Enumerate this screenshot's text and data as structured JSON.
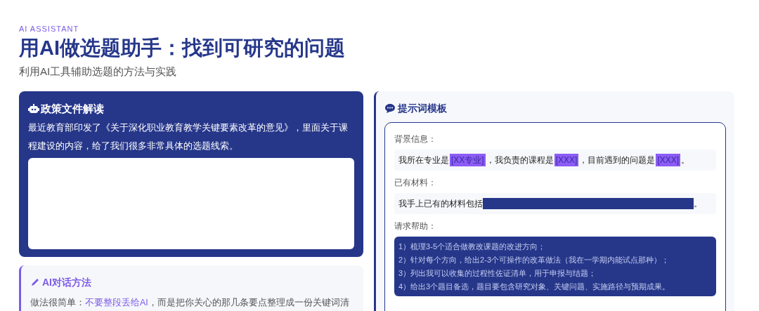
{
  "header": {
    "eyebrow": "AI ASSISTANT",
    "title": "用AI做选题助手：找到可研究的问题",
    "subtitle": "利用AI工具辅助选题的方法与实践"
  },
  "policy_card": {
    "title": "政策文件解读",
    "body": "最近教育部印发了《关于深化职业教育教学关键要素改革的意见》，里面关于课程建设的内容，给了我们很多非常具体的选题线索。"
  },
  "method_card": {
    "title": "AI对话方法",
    "segments": [
      {
        "text": "做法很简单：",
        "highlight": false
      },
      {
        "text": "不要整段丢给AI",
        "highlight": true
      },
      {
        "text": "，而是把你关心的那几条要点整理成一份关键词清",
        "highlight": false
      }
    ]
  },
  "template_card": {
    "title": "提示词模板",
    "sections": [
      {
        "label": "背景信息：",
        "kind": "line",
        "segments": [
          {
            "kind": "text",
            "text": "我所在专业是"
          },
          {
            "kind": "placeholder",
            "text": "[XX专业]"
          },
          {
            "kind": "text",
            "text": "，我负责的课程是"
          },
          {
            "kind": "placeholder",
            "text": "[XXX]"
          },
          {
            "kind": "text",
            "text": "，目前遇到的问题是"
          },
          {
            "kind": "placeholder",
            "text": "[XXX]"
          },
          {
            "kind": "text",
            "text": "。"
          }
        ]
      },
      {
        "label": "已有材料：",
        "kind": "line",
        "segments": [
          {
            "kind": "text",
            "text": "我手上已有的材料包括"
          },
          {
            "kind": "blank"
          },
          {
            "kind": "text",
            "text": "。"
          }
        ]
      },
      {
        "label": "请求帮助：",
        "kind": "list",
        "items": [
          "1）梳理3-5个适合做教改课题的改进方向；",
          "2）针对每个方向，给出2-3个可操作的改革做法（我在一学期内能试点那种）；",
          "3）列出我可以收集的过程性佐证清单，用于申报与结题；",
          "4）给出3个题目备选，题目要包含研究对象、关键问题、实施路径与预期成果。"
        ]
      }
    ]
  }
}
